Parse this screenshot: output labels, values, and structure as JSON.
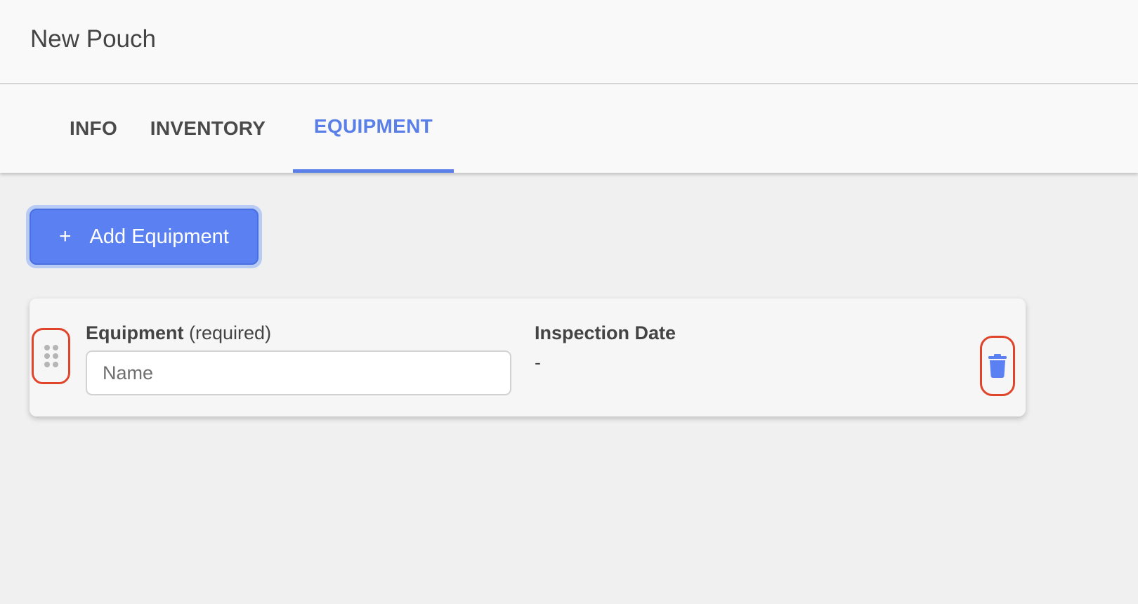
{
  "header": {
    "title": "New Pouch"
  },
  "tabs": [
    {
      "label": "INFO",
      "active": false
    },
    {
      "label": "INVENTORY",
      "active": false
    },
    {
      "label": "EQUIPMENT",
      "active": true
    }
  ],
  "toolbar": {
    "add_equipment_icon": "+",
    "add_equipment_label": "Add Equipment"
  },
  "equipment_card": {
    "equipment_label": "Equipment",
    "equipment_required": "(required)",
    "name_placeholder": "Name",
    "name_value": "",
    "inspection_label": "Inspection Date",
    "inspection_value": "-",
    "drag_icon": "drag-handle-icon",
    "delete_icon": "trash-icon"
  },
  "colors": {
    "accent": "#5b7fe8",
    "button": "#5a80f2",
    "highlight": "#e0452c"
  }
}
